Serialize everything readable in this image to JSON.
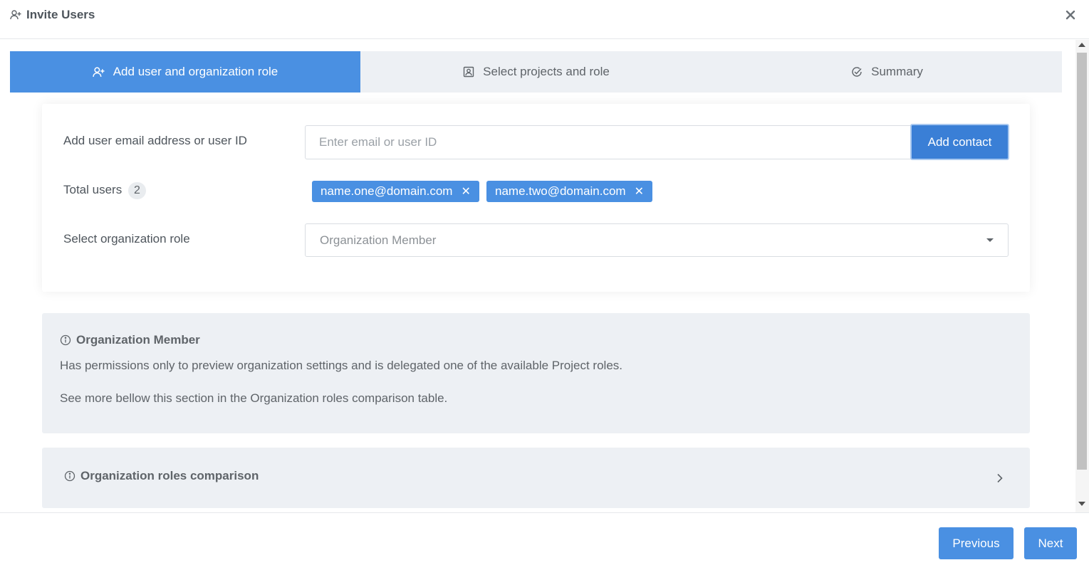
{
  "header": {
    "title": "Invite Users",
    "title_icon": "user-plus-icon",
    "close_icon": "close-icon"
  },
  "steps": [
    {
      "label": "Add user and organization role",
      "icon": "user-plus-icon",
      "active": true
    },
    {
      "label": "Select projects and role",
      "icon": "contact-card-icon",
      "active": false
    },
    {
      "label": "Summary",
      "icon": "check-circle-icon",
      "active": false
    }
  ],
  "form": {
    "email_label": "Add user email address or user ID",
    "email_placeholder": "Enter email or user ID",
    "email_value": "",
    "add_button": "Add contact",
    "total_label": "Total users",
    "total_count": "2",
    "users": [
      "name.one@domain.com",
      "name.two@domain.com"
    ],
    "role_label": "Select organization role",
    "role_value": "Organization Member"
  },
  "info": {
    "title": "Organization Member",
    "description": "Has permissions only to preview organization settings and is delegated one of the available Project roles.",
    "more": "See more bellow this section in the Organization roles comparison table."
  },
  "accordion": {
    "title": "Organization roles comparison"
  },
  "footer": {
    "previous": "Previous",
    "next": "Next"
  },
  "colors": {
    "primary": "#4a90e2",
    "panel": "#edf0f4",
    "text": "#5f6469"
  }
}
